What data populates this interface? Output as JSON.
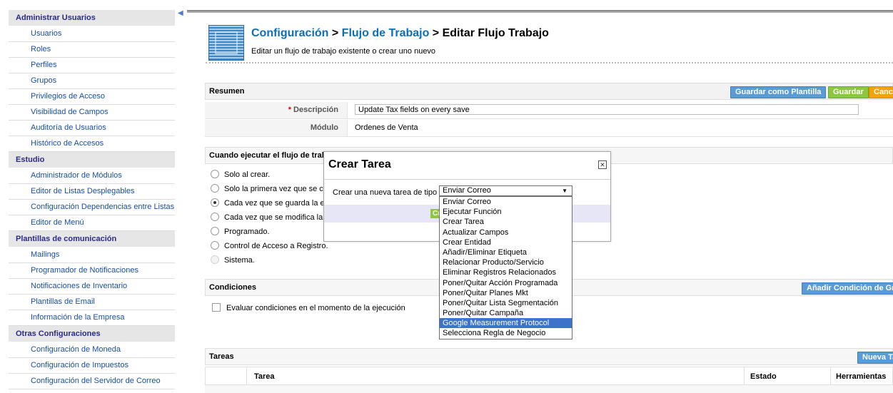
{
  "sidebar": {
    "toggle_icon": "collapse-left-icon",
    "sections": [
      {
        "title": "Administrar Usuarios",
        "items": [
          "Usuarios",
          "Roles",
          "Perfiles",
          "Grupos",
          "Privilegios de Acceso",
          "Visibilidad de Campos",
          "Auditoría de Usuarios",
          "Histórico de Accesos"
        ]
      },
      {
        "title": "Estudio",
        "items": [
          "Administrador de Módulos",
          "Editor de Listas Desplegables",
          "Configuración Dependencias entre Listas",
          "Editor de Menú"
        ]
      },
      {
        "title": "Plantillas de comunicación",
        "items": [
          "Mailings",
          "Programador de Notificaciones",
          "Notificaciones de Inventario",
          "Plantillas de Email",
          "Información de la Empresa"
        ]
      },
      {
        "title": "Otras Configuraciones",
        "items": [
          "Configuración de Moneda",
          "Configuración de Impuestos",
          "Configuración del Servidor de Correo"
        ]
      }
    ]
  },
  "header": {
    "crumb1": "Configuración",
    "sep1": " > ",
    "crumb2": "Flujo de Trabajo",
    "sep2": " > ",
    "current": "Editar Flujo Trabajo",
    "subtitle": "Editar un flujo de trabajo existente o crear uno nuevo"
  },
  "resumen": {
    "title": "Resumen",
    "btn_template": "Guardar como Plantilla",
    "btn_save": "Guardar",
    "btn_cancel": "Cancelar",
    "desc_required": "*",
    "desc_label": " Descripción",
    "desc_value": "Update Tax fields on every save",
    "module_label": "Módulo",
    "module_value": "Ordenes de Venta"
  },
  "trigger": {
    "title": "Cuando ejecutar el flujo de trabajo",
    "options": [
      "Solo al crear.",
      "Solo la primera vez que se c",
      "Cada vez que se guarda la e",
      "Cada vez que se modifica la",
      "Programado.",
      "Control de Acceso a Registro.",
      "Sistema."
    ],
    "selected_index": 2,
    "disabled_index": 6
  },
  "conditions": {
    "title": "Condiciones",
    "btn_add": "Añadir Condición de Grupo",
    "checkbox_label": "Evaluar condiciones en el momento de la ejecución"
  },
  "tasks": {
    "title": "Tareas",
    "btn_new": "Nueva Tarea",
    "columns": {
      "task": "Tarea",
      "status": "Estado",
      "tools": "Herramientas"
    }
  },
  "dialog": {
    "title": "Crear Tarea",
    "close_icon": "close-icon",
    "label": "Crear una nueva tarea de tipo",
    "selected": "Enviar Correo",
    "ok_label": "Crear",
    "options": [
      "Enviar Correo",
      "Ejecutar Función",
      "Crear Tarea",
      "Actualizar Campos",
      "Crear Entidad",
      "Añadir/Eliminar Etiqueta",
      "Relacionar Producto/Servicio",
      "Eliminar Registros Relacionados",
      "Poner/Quitar Acción Programada",
      "Poner/Quitar Planes Mkt",
      "Poner/Quitar Lista Segmentación",
      "Poner/Quitar Campaña",
      "Google Measurement Protocol",
      "Selecciona Regla de Negocio"
    ],
    "highlighted_index": 12
  }
}
